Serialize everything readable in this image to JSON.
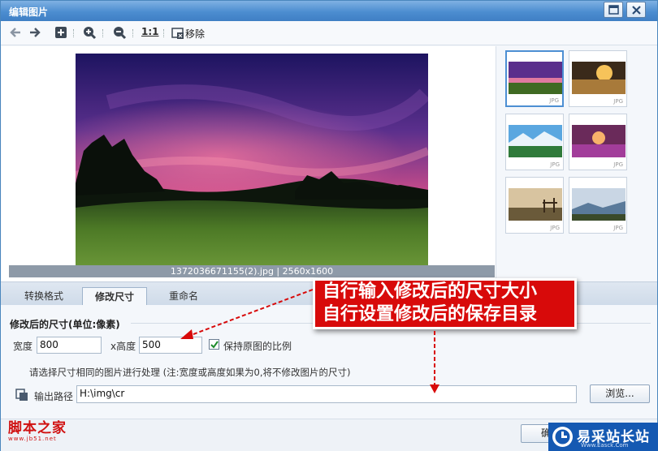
{
  "window": {
    "title": "编辑图片"
  },
  "toolbar": {
    "one_to_one": "1:1",
    "remove_label": "移除"
  },
  "preview": {
    "caption": "1372036671155(2).jpg | 2560x1600"
  },
  "thumbnails": {
    "ext": "JPG"
  },
  "tabs": [
    {
      "label": "转换格式"
    },
    {
      "label": "修改尺寸"
    },
    {
      "label": "重命名"
    }
  ],
  "resize": {
    "section_title": "修改后的尺寸(单位:像素)",
    "width_label": "宽度",
    "width_value": "800",
    "height_label": "x高度",
    "height_value": "500",
    "keep_ratio_label": "保持原图的比例",
    "note": "请选择尺寸相同的图片进行处理 (注:宽度或高度如果为0,将不修改图片的尺寸)",
    "output_label": "输出路径",
    "output_value": "H:\\img\\cr",
    "browse_label": "浏览..."
  },
  "footer": {
    "confirm_label": "确"
  },
  "callout": {
    "line1": "自行输入修改后的尺寸大小",
    "line2": "自行设置修改后的保存目录"
  },
  "watermark_left": {
    "name": "脚本之家",
    "url": "www.jb51.net"
  },
  "watermark_right": {
    "name": "易采站长站",
    "url": "Www.Easck.Com"
  }
}
